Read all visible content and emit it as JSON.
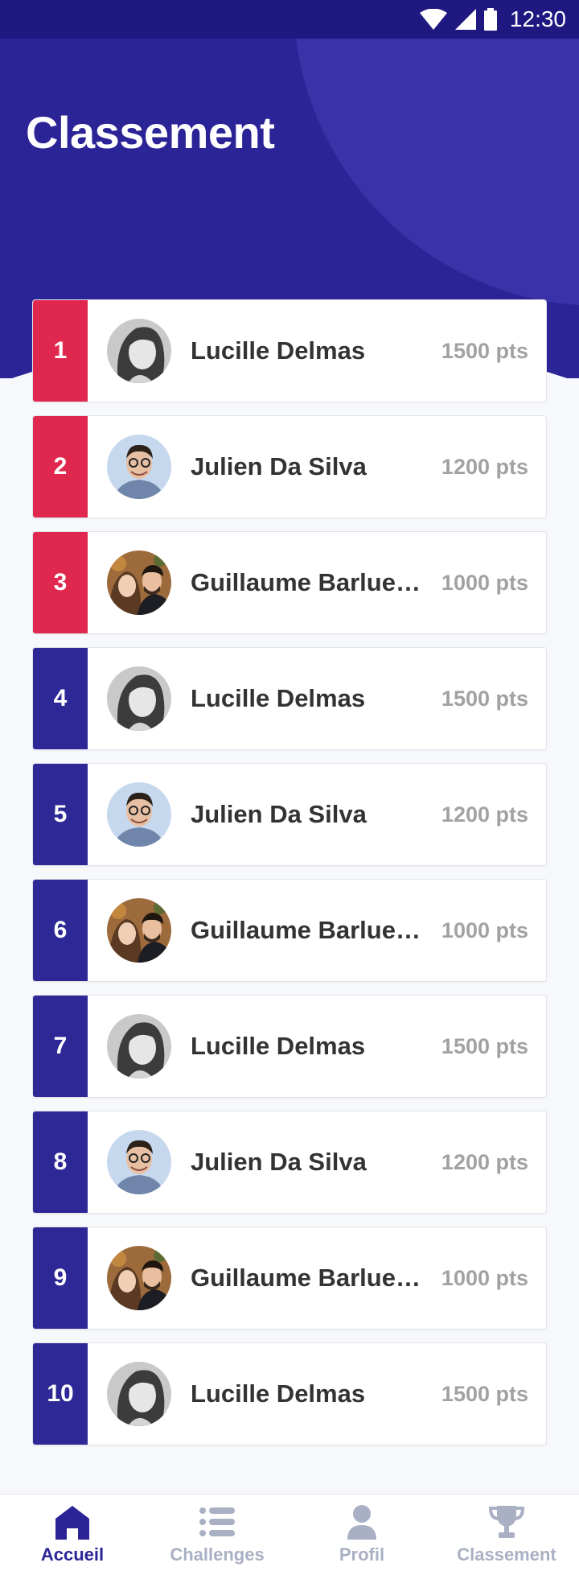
{
  "status_bar": {
    "time": "12:30",
    "icons": [
      "wifi-icon",
      "signal-icon",
      "battery-icon"
    ]
  },
  "page": {
    "title": "Classement"
  },
  "colors": {
    "header_bg": "#2b2497",
    "top_rank": "#e0284e",
    "normal_rank": "#2d2896",
    "points_text": "#a2a2a2",
    "nav_active": "#2b2497",
    "nav_inactive": "#aab0c4"
  },
  "leaderboard": [
    {
      "rank": "1",
      "name": "Lucille Delmas",
      "points": "1500 pts",
      "avatar": "avatar-lucille"
    },
    {
      "rank": "2",
      "name": "Julien Da Silva",
      "points": "1200 pts",
      "avatar": "avatar-julien"
    },
    {
      "rank": "3",
      "name": "Guillaume Barluet …",
      "points": "1000 pts",
      "avatar": "avatar-guillaume"
    },
    {
      "rank": "4",
      "name": "Lucille Delmas",
      "points": "1500 pts",
      "avatar": "avatar-lucille"
    },
    {
      "rank": "5",
      "name": "Julien Da Silva",
      "points": "1200 pts",
      "avatar": "avatar-julien"
    },
    {
      "rank": "6",
      "name": "Guillaume Barluet …",
      "points": "1000 pts",
      "avatar": "avatar-guillaume"
    },
    {
      "rank": "7",
      "name": "Lucille Delmas",
      "points": "1500 pts",
      "avatar": "avatar-lucille"
    },
    {
      "rank": "8",
      "name": "Julien Da Silva",
      "points": "1200 pts",
      "avatar": "avatar-julien"
    },
    {
      "rank": "9",
      "name": "Guillaume Barluet …",
      "points": "1000 pts",
      "avatar": "avatar-guillaume"
    },
    {
      "rank": "10",
      "name": "Lucille Delmas",
      "points": "1500 pts",
      "avatar": "avatar-lucille"
    }
  ],
  "bottom_nav": {
    "items": [
      {
        "label": "Accueil",
        "icon": "home-icon",
        "active": true
      },
      {
        "label": "Challenges",
        "icon": "list-icon",
        "active": false
      },
      {
        "label": "Profil",
        "icon": "user-icon",
        "active": false
      },
      {
        "label": "Classement",
        "icon": "trophy-icon",
        "active": false
      }
    ]
  }
}
